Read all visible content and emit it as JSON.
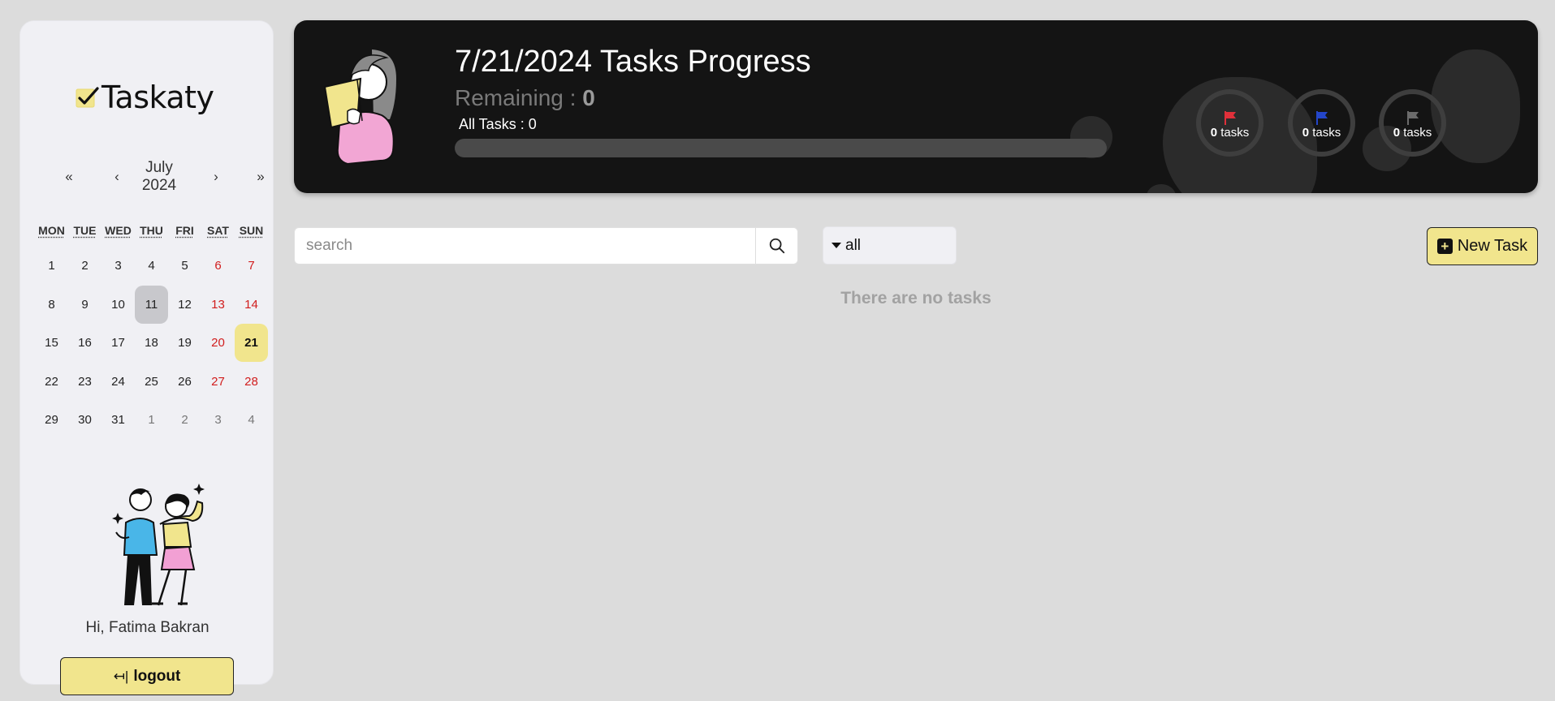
{
  "sidebar": {
    "logo_text": "Taskaty",
    "calendar": {
      "prev_year": "«",
      "prev_month": "‹",
      "month": "July",
      "year": "2024",
      "next_month": "›",
      "next_year": "»",
      "weekdays": [
        "MON",
        "TUE",
        "WED",
        "THU",
        "FRI",
        "SAT",
        "SUN"
      ],
      "days": [
        {
          "d": "1"
        },
        {
          "d": "2"
        },
        {
          "d": "3"
        },
        {
          "d": "4"
        },
        {
          "d": "5"
        },
        {
          "d": "6",
          "weekend": true
        },
        {
          "d": "7",
          "weekend": true
        },
        {
          "d": "8"
        },
        {
          "d": "9"
        },
        {
          "d": "10"
        },
        {
          "d": "11",
          "selected": true
        },
        {
          "d": "12"
        },
        {
          "d": "13",
          "weekend": true
        },
        {
          "d": "14",
          "weekend": true
        },
        {
          "d": "15"
        },
        {
          "d": "16"
        },
        {
          "d": "17"
        },
        {
          "d": "18"
        },
        {
          "d": "19"
        },
        {
          "d": "20",
          "weekend": true
        },
        {
          "d": "21",
          "today": true
        },
        {
          "d": "22"
        },
        {
          "d": "23"
        },
        {
          "d": "24"
        },
        {
          "d": "25"
        },
        {
          "d": "26"
        },
        {
          "d": "27",
          "weekend": true
        },
        {
          "d": "28",
          "weekend": true
        },
        {
          "d": "29"
        },
        {
          "d": "30"
        },
        {
          "d": "31"
        },
        {
          "d": "1",
          "other": true
        },
        {
          "d": "2",
          "other": true
        },
        {
          "d": "3",
          "other": true
        },
        {
          "d": "4",
          "other": true
        }
      ]
    },
    "greeting": "Hi, Fatima Bakran",
    "logout_label": "logout",
    "logout_icon": "logout-arrow-icon"
  },
  "banner": {
    "title": "7/21/2024 Tasks Progress",
    "remaining_label": "Remaining : ",
    "remaining_value": "0",
    "all_tasks": "All Tasks : 0",
    "progress_fraction": 0,
    "flags": [
      {
        "icon": "red-flag-icon",
        "color": "#e0303a",
        "count": "0",
        "unit": " tasks"
      },
      {
        "icon": "blue-flag-icon",
        "color": "#2446c9",
        "count": "0",
        "unit": " tasks"
      },
      {
        "icon": "gray-flag-icon",
        "color": "#6b6b6b",
        "count": "0",
        "unit": " tasks"
      }
    ]
  },
  "toolbar": {
    "search_placeholder": "search",
    "filter_value": "all",
    "new_task_label": "New Task"
  },
  "empty_message": "There are no tasks",
  "colors": {
    "accent": "#f1e58d",
    "banner_bg": "#141414",
    "page_bg": "#dcdcdc",
    "sidebar_bg": "#f0f0f4",
    "weekend": "#d11d1d"
  }
}
